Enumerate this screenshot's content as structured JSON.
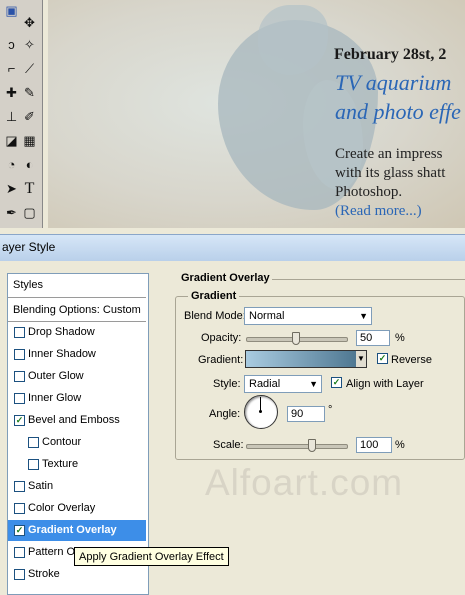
{
  "canvas": {
    "date": "February 28st, 2",
    "title_line1": "TV aquarium",
    "title_line2": "and photo effe",
    "body_line1": "Create an impress",
    "body_line2": "with its glass shatt",
    "body_line3": "Photoshop.",
    "read_more": "(Read more...)"
  },
  "dialog": {
    "title": "ayer Style",
    "styles_header": "Styles",
    "blending_options": "Blending Options: Custom",
    "items": [
      {
        "label": "Drop Shadow",
        "checked": false
      },
      {
        "label": "Inner Shadow",
        "checked": false
      },
      {
        "label": "Outer Glow",
        "checked": false
      },
      {
        "label": "Inner Glow",
        "checked": false
      },
      {
        "label": "Bevel and Emboss",
        "checked": true
      },
      {
        "label": "Contour",
        "checked": false
      },
      {
        "label": "Texture",
        "checked": false
      },
      {
        "label": "Satin",
        "checked": false
      },
      {
        "label": "Color Overlay",
        "checked": false
      },
      {
        "label": "Gradient Overlay",
        "checked": true,
        "selected": true
      },
      {
        "label": "Pattern Ov",
        "checked": false
      },
      {
        "label": "Stroke",
        "checked": false
      }
    ],
    "check_mark": "✓"
  },
  "panel": {
    "outer_title": "Gradient Overlay",
    "inner_title": "Gradient",
    "blend_mode_label": "Blend Mode:",
    "blend_mode_value": "Normal",
    "opacity_label": "Opacity:",
    "opacity_value": "50",
    "opacity_unit": "%",
    "opacity_level": 0.5,
    "gradient_label": "Gradient:",
    "gradient_colors": [
      "#a9cbe0",
      "#4f7892"
    ],
    "reverse_label": "Reverse",
    "reverse_checked": true,
    "style_label": "Style:",
    "style_value": "Radial",
    "align_label": "Align with Layer",
    "align_checked": true,
    "angle_label": "Angle:",
    "angle_value": "90",
    "angle_unit": "°",
    "scale_label": "Scale:",
    "scale_value": "100",
    "scale_unit": "%",
    "scale_level": 0.66
  },
  "tooltip": "Apply Gradient Overlay Effect",
  "watermark": "Alfoart.com",
  "icons": {
    "tool_text": "T",
    "arrow": "▼"
  }
}
